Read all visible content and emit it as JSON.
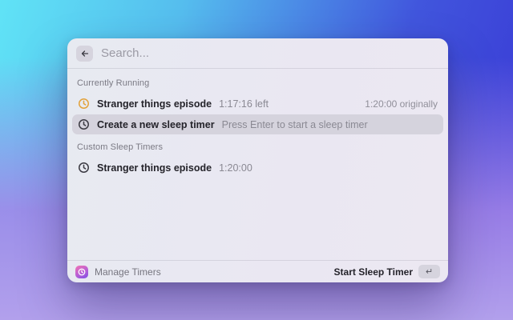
{
  "search": {
    "placeholder": "Search...",
    "back_icon": "arrow-left"
  },
  "colors": {
    "running_clock": "#E3A23A",
    "idle_clock": "#3C3B43",
    "selection": "#D5D3DD",
    "bg_gradient_top_left": "#60E3F6",
    "bg_gradient_top_right": "#3834D4",
    "bg_gradient_bottom": "#B2A0EC"
  },
  "sections": [
    {
      "title": "Currently Running",
      "items": [
        {
          "icon": "clock-icon",
          "icon_color": "#E3A23A",
          "title": "Stranger things episode",
          "subtitle": "1:17:16 left",
          "accessory": "1:20:00 originally",
          "selected": false
        },
        {
          "icon": "clock-icon",
          "icon_color": "#3C3B43",
          "title": "Create a new sleep timer",
          "subtitle": "Press Enter to start a sleep timer",
          "accessory": "",
          "selected": true
        }
      ]
    },
    {
      "title": "Custom Sleep Timers",
      "items": [
        {
          "icon": "clock-icon",
          "icon_color": "#3C3B43",
          "title": "Stranger things episode",
          "subtitle": "1:20:00",
          "accessory": "",
          "selected": false
        }
      ]
    }
  ],
  "footer": {
    "app_icon": "sleep-timer-app-icon",
    "left_label": "Manage Timers",
    "action_label": "Start Sleep Timer",
    "key_hint": "↵"
  }
}
